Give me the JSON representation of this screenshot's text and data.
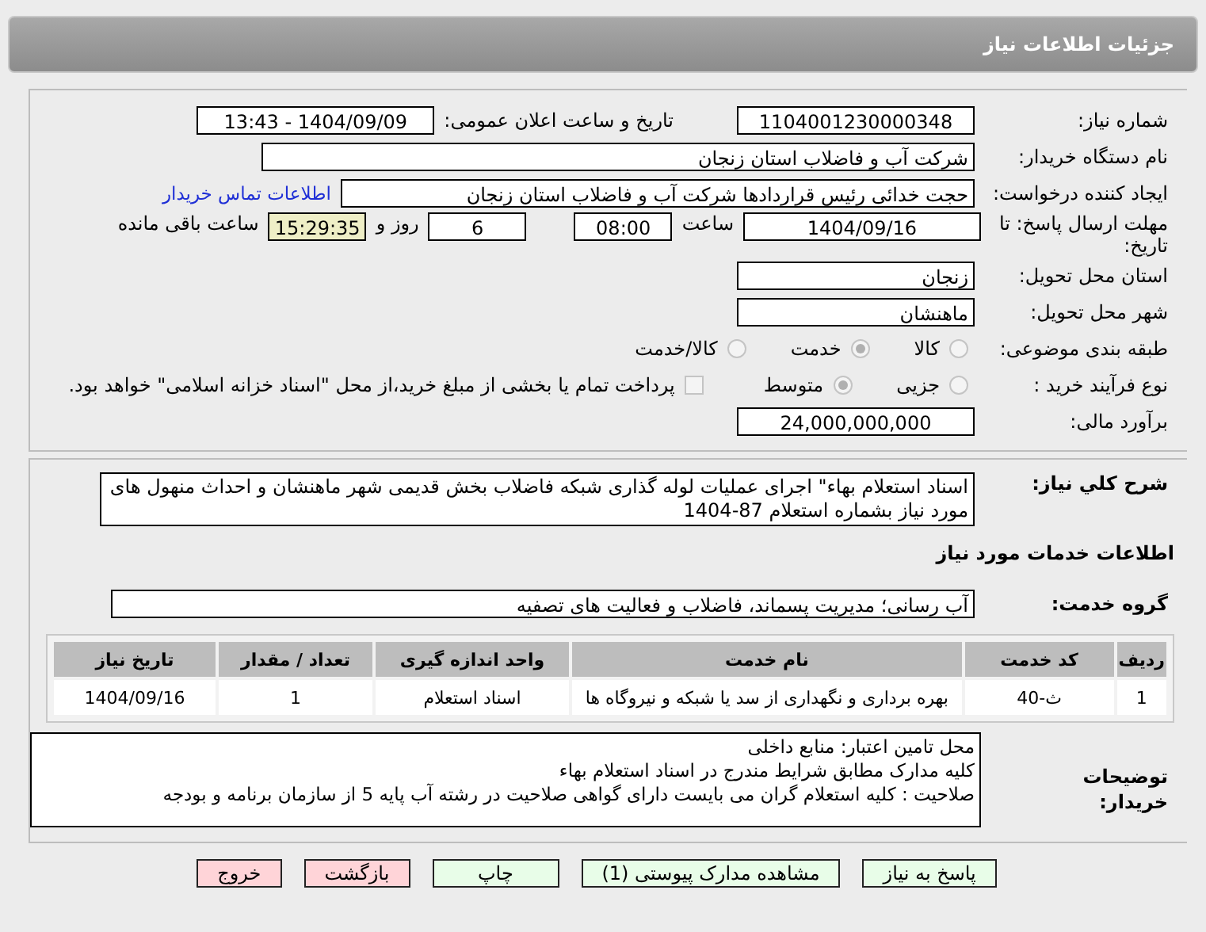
{
  "header": {
    "title": "جزئیات اطلاعات نیاز"
  },
  "need_number": {
    "label": "شماره نیاز:",
    "value": "1104001230000348"
  },
  "announcement": {
    "label": "تاریخ و ساعت اعلان عمومی:",
    "value": "1404/09/09 - 13:43"
  },
  "buyer": {
    "label": "نام دستگاه خریدار:",
    "value": "شرکت آب و فاضلاب استان زنجان"
  },
  "creator": {
    "label": "ایجاد کننده درخواست:",
    "value": "حجت  خدائی رئیس قراردادها شرکت آب و فاضلاب استان زنجان",
    "link": "اطلاعات تماس خریدار"
  },
  "deadline": {
    "label": "مهلت ارسال پاسخ: تا تاریخ:",
    "date": "1404/09/16",
    "time_label": "ساعت",
    "time": "08:00",
    "days": "6",
    "days_label": "روز و",
    "remaining": "15:29:35",
    "remaining_label": "ساعت باقی مانده"
  },
  "province": {
    "label": "استان محل تحویل:",
    "value": "زنجان"
  },
  "city": {
    "label": "شهر محل تحویل:",
    "value": "ماهنشان"
  },
  "category": {
    "label": "طبقه بندی موضوعی:",
    "options": [
      {
        "label": "کالا",
        "selected": false
      },
      {
        "label": "خدمت",
        "selected": true
      },
      {
        "label": "کالا/خدمت",
        "selected": false
      }
    ]
  },
  "purchase_type": {
    "label": "نوع فرآیند خرید :",
    "options": [
      {
        "label": "جزیی",
        "selected": false
      },
      {
        "label": "متوسط",
        "selected": true
      }
    ],
    "treasury": {
      "label": "پرداخت تمام یا بخشی از مبلغ خرید،از محل \"اسناد خزانه اسلامی\" خواهد بود.",
      "checked": false
    }
  },
  "budget": {
    "label": "برآورد مالی:",
    "value": "24,000,000,000"
  },
  "description": {
    "label": "شرح کلي نياز:",
    "value": "اسناد استعلام بهاء\" اجرای عملیات لوله گذاری شبکه فاضلاب بخش قدیمی شهر ماهنشان و احداث منهول های مورد نیاز بشماره استعلام 87-1404"
  },
  "services_title": "اطلاعات خدمات مورد نیاز",
  "service_group": {
    "label": "گروه خدمت:",
    "value": "آب رسانی؛ مدیریت پسماند، فاضلاب و فعالیت های تصفیه"
  },
  "table": {
    "columns": [
      "ردیف",
      "کد خدمت",
      "نام خدمت",
      "واحد اندازه گیری",
      "تعداد / مقدار",
      "تاریخ نیاز"
    ],
    "rows": [
      [
        "1",
        "ث-40",
        "بهره برداری و نگهداری از سد یا شبکه و نیروگاه ها",
        "اسناد استعلام",
        "1",
        "1404/09/16"
      ]
    ]
  },
  "notes": {
    "label": "توضیحات خریدار:",
    "lines": [
      "محل تامین اعتبار: منابع داخلی",
      "کلیه مدارک مطابق شرایط مندرج در اسناد استعلام بهاء",
      "صلاحیت : کلیه استعلام گران می بایست دارای گواهی صلاحیت در رشته آب پایه 5 از سازمان برنامه و بودجه"
    ]
  },
  "buttons": [
    {
      "label": "پاسخ به نیاز",
      "kind": "normal"
    },
    {
      "label": "مشاهده مدارک پیوستی (1)",
      "kind": "normal"
    },
    {
      "label": "چاپ",
      "kind": "normal"
    },
    {
      "label": "بازگشت",
      "kind": "danger"
    },
    {
      "label": "خروج",
      "kind": "danger"
    }
  ]
}
